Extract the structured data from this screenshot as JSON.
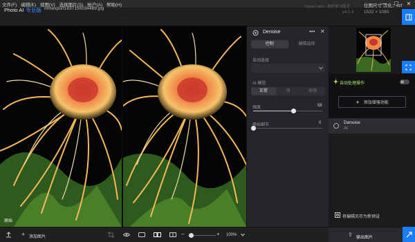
{
  "menu": [
    "文件(F)",
    "编辑(E)",
    "视图(V)",
    "选择图片(S)",
    "帐户(A)",
    "帮助(H)"
  ],
  "window_controls": {
    "minimize": "—",
    "maximize": "☐",
    "close": "✕"
  },
  "app": {
    "name": "Photo AI",
    "edition": "专业版",
    "file_name": "mmexport1637155034489.jpg",
    "logo_text": "Topaz Labs · 你的学习助手",
    "version": "v4.0.4"
  },
  "image_info": {
    "label": "位图尺寸 汉化：xzf",
    "size": "1532 × 1080"
  },
  "panel": {
    "title": "Denoise",
    "tabs": [
      {
        "label": "控制",
        "active": true
      },
      {
        "label": "编辑选择",
        "active": false
      }
    ],
    "auto_select_label": "自动选择",
    "model_label": "AI 模型",
    "models": [
      {
        "label": "正常",
        "active": true
      },
      {
        "label": "强",
        "active": false
      },
      {
        "label": "很强",
        "active": false
      }
    ],
    "strength": {
      "label": "强度",
      "value": 58,
      "fraction": 0.58
    },
    "recover": {
      "label": "原始细节",
      "value": 0,
      "fraction": 0.0
    }
  },
  "autopilot": {
    "title": "自动处理操作",
    "enabled": false,
    "add_filter": "添加增强功能"
  },
  "filters": [
    {
      "name": "Denoise",
      "model": "AI"
    }
  ],
  "save_preset": "将编辑另存为新预设",
  "bottom": {
    "add_image": "添加图片",
    "zoom": "100%",
    "original_label": "原始",
    "export": "输出图片"
  },
  "colors": {
    "accent": "#1b7cf3",
    "autopilot_green": "#b5e06a"
  }
}
